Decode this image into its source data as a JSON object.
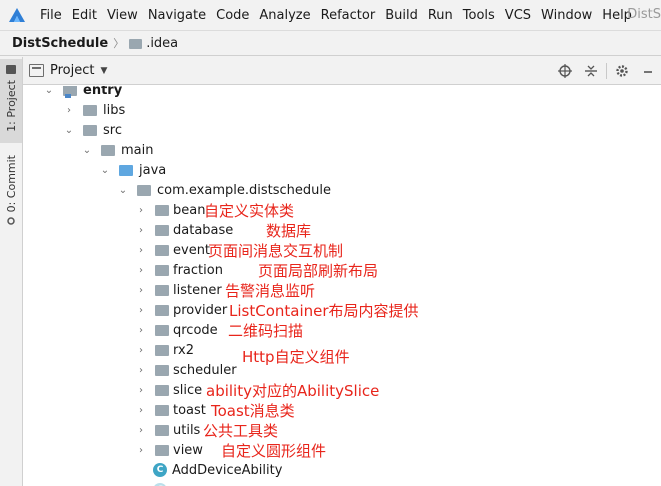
{
  "menu": [
    "File",
    "Edit",
    "View",
    "Navigate",
    "Code",
    "Analyze",
    "Refactor",
    "Build",
    "Run",
    "Tools",
    "VCS",
    "Window",
    "Help"
  ],
  "title_fragment": "DistS",
  "breadcrumb": {
    "project": "DistSchedule",
    "folder": ".idea"
  },
  "stripe": {
    "project_tab": "1: Project",
    "commit_tab": "0: Commit"
  },
  "panel": {
    "title": "Project"
  },
  "tree": {
    "entry": "entry",
    "libs": "libs",
    "src": "src",
    "main": "main",
    "java": "java",
    "package": "com.example.distschedule",
    "bean": "bean",
    "database": "database",
    "event": "event",
    "fraction": "fraction",
    "listener": "listener",
    "provider": "provider",
    "qrcode": "qrcode",
    "rx2": "rx2",
    "scheduler": "scheduler",
    "slice": "slice",
    "toast": "toast",
    "utils": "utils",
    "view": "view",
    "add_device": "AddDeviceAbility"
  },
  "annotations": {
    "bean": "自定义实体类",
    "database": "数据库",
    "event": "页面间消息交互机制",
    "fraction": "页面局部刷新布局",
    "listener": "告警消息监听",
    "provider": "ListContainer布局内容提供",
    "qrcode": "二维码扫描",
    "rx2": "Http自定义组件",
    "slice": "ability对应的AbilitySlice",
    "toast": "Toast消息类",
    "utils": "公共工具类",
    "view": "自定义圆形组件"
  },
  "colors": {
    "annotation": "#e8251b",
    "folder": "#9aa7b0",
    "source_folder": "#5fa7e0",
    "class_icon": "#3ea5c5"
  },
  "icons": [
    "app-logo-icon",
    "folder-icon",
    "project-view-icon",
    "locate-icon",
    "collapse-all-icon",
    "settings-icon",
    "minimize-icon",
    "class-icon"
  ]
}
